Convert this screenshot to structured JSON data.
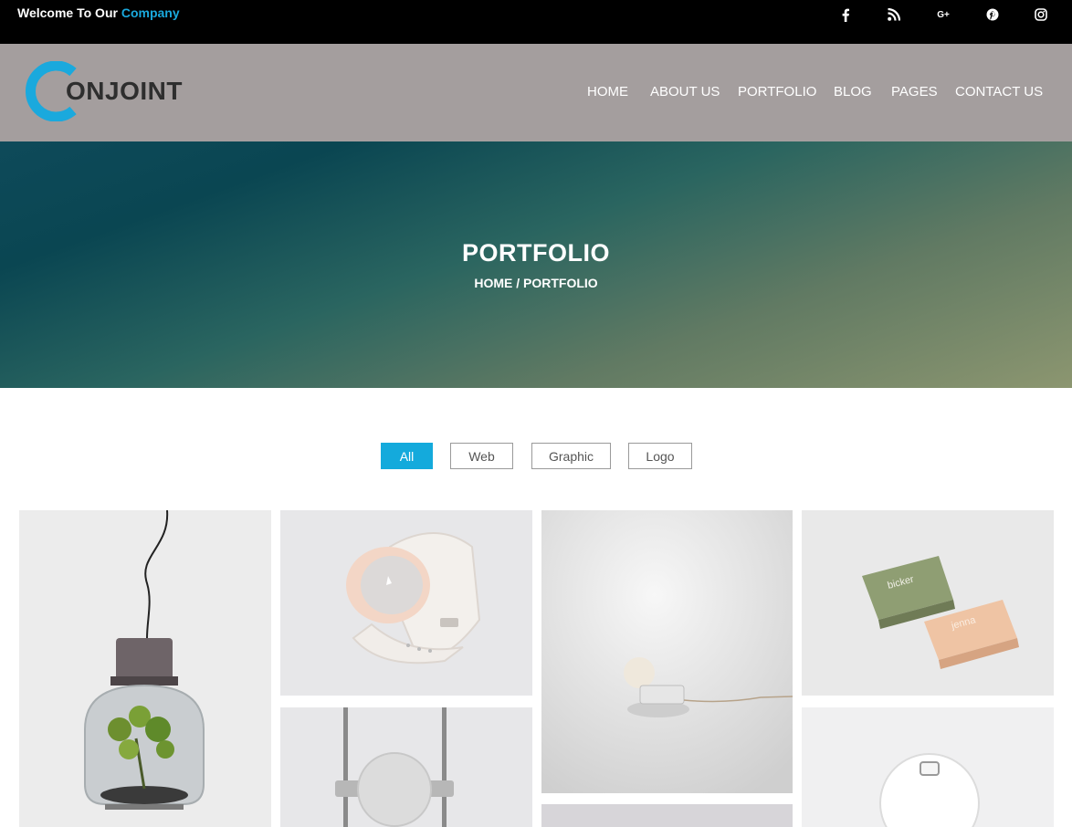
{
  "topbar": {
    "welcome_prefix": "Welcome To Our",
    "welcome_accent": "Company",
    "social": [
      "facebook-icon",
      "rss-icon",
      "google-plus-icon",
      "pinterest-icon",
      "instagram-icon"
    ],
    "google_plus_label": "G+"
  },
  "header": {
    "logo_text": "ONJOINT",
    "nav": [
      "HOME",
      "ABOUT US",
      "PORTFOLIO",
      "BLOG",
      "PAGES",
      "CONTACT US"
    ]
  },
  "hero": {
    "title": "PORTFOLIO",
    "breadcrumb": "HOME / PORTFOLIO"
  },
  "filters": [
    "All",
    "Web",
    "Graphic",
    "Logo"
  ],
  "active_filter": "All",
  "colors": {
    "accent": "#14aadc",
    "topbar": "#000000",
    "header": "#a49e9e"
  },
  "gallery": {
    "items": [
      {
        "subject": "pendant-terrarium-lamp"
      },
      {
        "subject": "white-wristwatch"
      },
      {
        "subject": "ceramic-sphere-lamp"
      },
      {
        "subject": "business-cards",
        "card_texts": [
          "bicker",
          "jenna"
        ]
      },
      {
        "subject": "sphere-pendant"
      },
      {
        "subject": "white-device"
      }
    ]
  }
}
